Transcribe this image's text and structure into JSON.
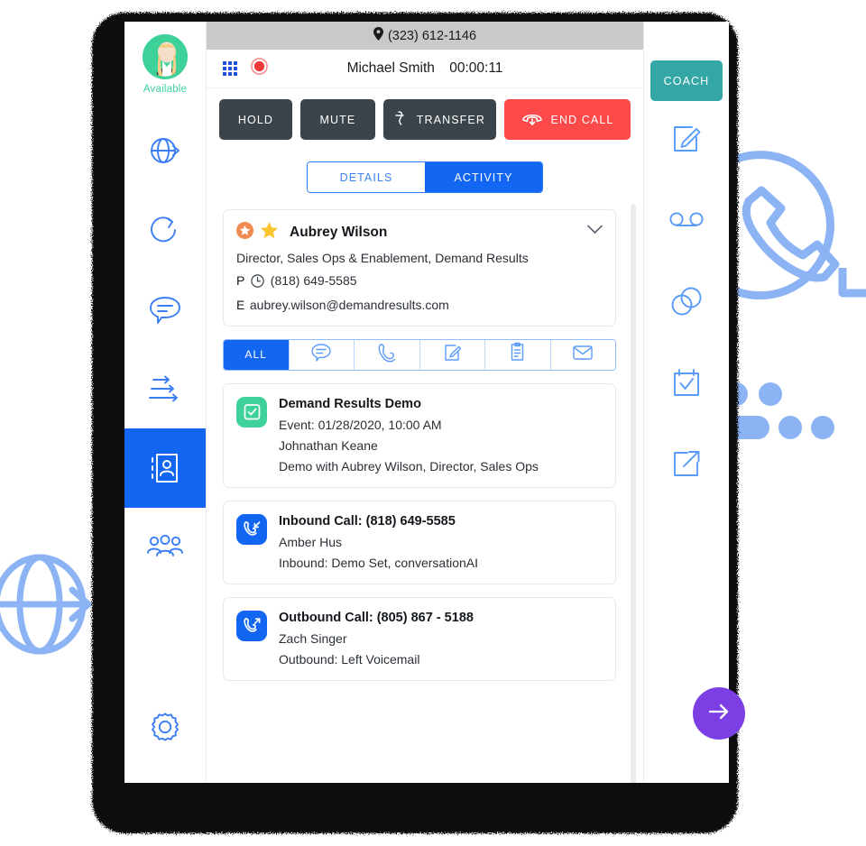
{
  "app": {
    "location_bar": {
      "phone": "(323) 612-1146",
      "pin_icon": "location-pin-icon"
    },
    "call_bar": {
      "dialpad_icon": "dialpad-icon",
      "record_icon": "record-icon",
      "caller_name": "Michael Smith",
      "timer": "00:00:11"
    },
    "actions": {
      "hold": "HOLD",
      "mute": "MUTE",
      "transfer": "TRANSFER",
      "end_call": "END CALL",
      "coach": "COACH",
      "transfer_icon": "transfer-call-icon",
      "end_call_icon": "hang-up-icon"
    },
    "user": {
      "status": "Available",
      "avatar_icon": "user-avatar"
    },
    "tabs": [
      {
        "label": "DETAILS",
        "active": false
      },
      {
        "label": "ACTIVITY",
        "active": true
      }
    ],
    "contact": {
      "name": "Aubrey Wilson",
      "title": "Director, Sales Ops & Enablement, Demand Results",
      "phone_label": "P",
      "phone": "(818) 649-5585",
      "email_label": "E",
      "email": "aubrey.wilson@demandresults.com",
      "badge_icon": "star-badge-icon",
      "favorite_icon": "star-icon",
      "expand_icon": "chevron-down-icon",
      "clock_icon": "clock-icon"
    },
    "filters": [
      {
        "label": "ALL",
        "icon": "all-filter",
        "active": true
      },
      {
        "label": "",
        "icon": "chat-bubble-icon",
        "active": false
      },
      {
        "label": "",
        "icon": "phone-icon",
        "active": false
      },
      {
        "label": "",
        "icon": "note-edit-icon",
        "active": false
      },
      {
        "label": "",
        "icon": "clipboard-icon",
        "active": false
      },
      {
        "label": "",
        "icon": "envelope-icon",
        "active": false
      }
    ],
    "activities": [
      {
        "icon": "calendar-check-icon",
        "icon_color": "#3ed29a",
        "title": "Demand Results Demo",
        "lines": [
          "Event: 01/28/2020, 10:00 AM",
          "Johnathan Keane",
          "Demo with Aubrey Wilson, Director, Sales Ops"
        ]
      },
      {
        "icon": "inbound-call-icon",
        "icon_color": "#1366f2",
        "title": "Inbound Call: (818) 649-5585",
        "lines": [
          "Amber Hus",
          "Inbound: Demo Set, conversationAI"
        ]
      },
      {
        "icon": "outbound-call-icon",
        "icon_color": "#1366f2",
        "title": "Outbound Call: (805) 867 - 5188",
        "lines": [
          "Zach Singer",
          "Outbound: Left Voicemail"
        ]
      }
    ],
    "left_rail_icons": [
      {
        "name": "globe-arrow-icon",
        "active": false
      },
      {
        "name": "refresh-circle-icon",
        "active": false
      },
      {
        "name": "chat-bubble-icon",
        "active": false
      },
      {
        "name": "arrows-flow-icon",
        "active": false
      },
      {
        "name": "contact-book-icon",
        "active": true
      },
      {
        "name": "team-people-icon",
        "active": false
      },
      {
        "name": "settings-gear-icon",
        "active": false
      }
    ],
    "right_rail_icons": [
      {
        "name": "note-edit-icon"
      },
      {
        "name": "voicemail-icon"
      },
      {
        "name": "link-circles-icon"
      },
      {
        "name": "calendar-check-icon"
      },
      {
        "name": "external-link-icon"
      }
    ],
    "fab": {
      "icon": "arrow-right-icon"
    },
    "colors": {
      "primary_blue": "#1366f2",
      "danger_red": "#fc4a4a",
      "dark_button": "#3b444b",
      "teal_coach": "#35a6a6",
      "green_status": "#3ed29a",
      "purple_fab": "#7b3fe4",
      "light_blue_deco": "#8cb4f5"
    }
  }
}
